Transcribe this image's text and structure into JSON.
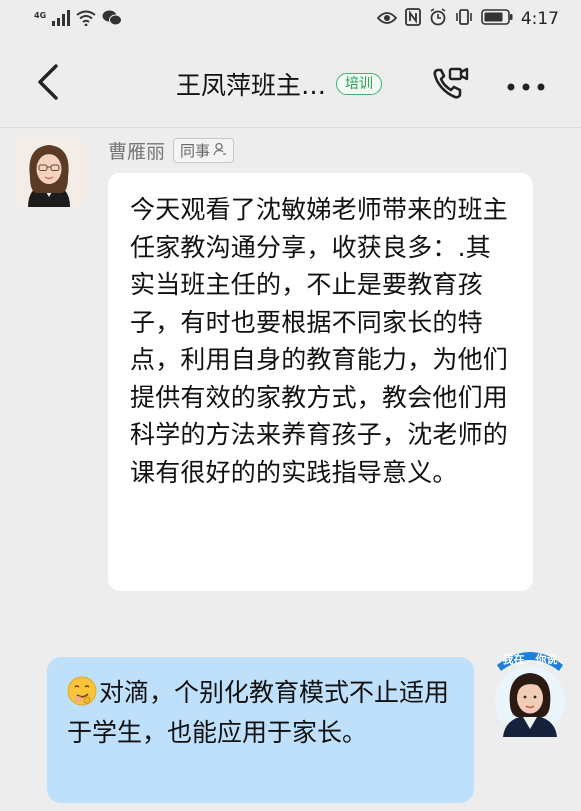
{
  "status_bar": {
    "network": "4G",
    "time": "4:17",
    "icons": [
      "signal-icon",
      "wifi-icon",
      "wechat-icon",
      "eye-icon",
      "nfc-icon",
      "alarm-icon",
      "vibrate-icon",
      "battery-icon"
    ]
  },
  "nav": {
    "title": "王凤萍班主…",
    "badge": "培训",
    "icons": [
      "back-arrow-icon",
      "voice-video-call-icon",
      "more-dots-icon"
    ]
  },
  "messages": [
    {
      "side": "left",
      "sender": "曹雁丽",
      "sender_tag": "同事",
      "text": "今天观看了沈敏娣老师带来的班主任家教沟通分享，收获良多：.其实当班主任的，不止是要教育孩子，有时也要根据不同家长的特点，利用自身的教育能力，为他们提供有效的家教方式，教会他们用科学的方法来养育孩子，沈老师的课有很好的的实践指导意义。"
    },
    {
      "side": "right",
      "emoji": "smirk-face-emoji",
      "text": "对滴，个别化教育模式不止适用于学生，也能应用于家长。",
      "avatar_badge": "我在，你说"
    }
  ],
  "colors": {
    "background": "#ededed",
    "left_bubble": "#ffffff",
    "right_bubble": "#bfe0fb",
    "badge_green": "#3cb371"
  }
}
